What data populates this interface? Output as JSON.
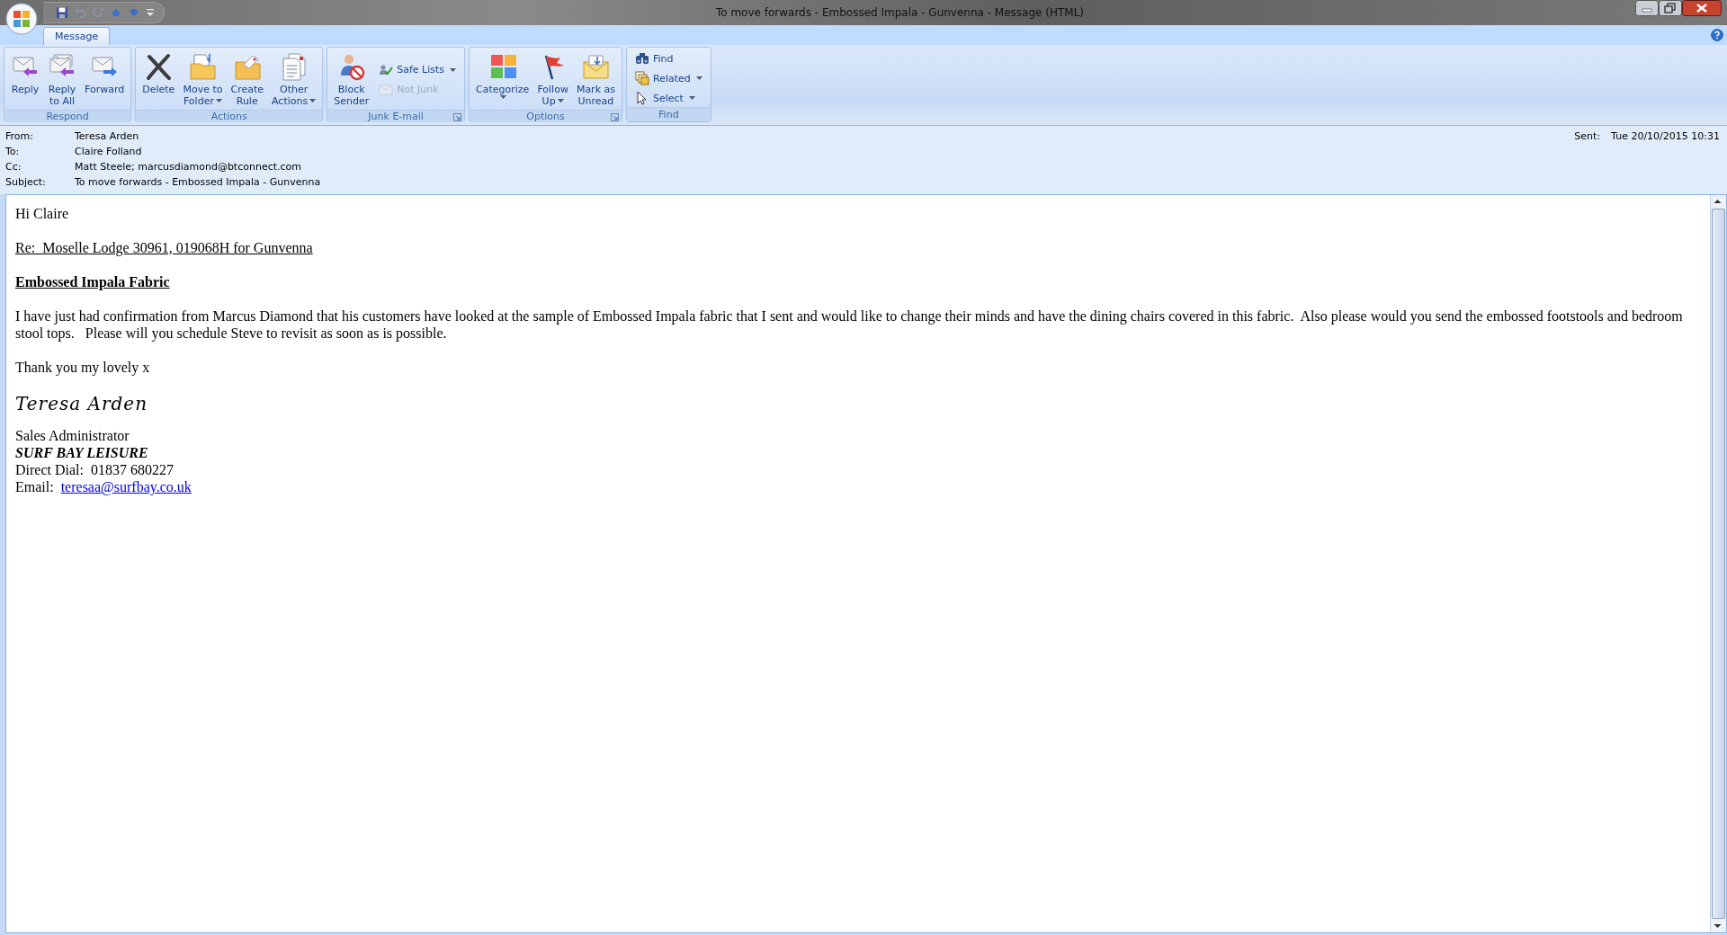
{
  "window": {
    "title": "To move forwards - Embossed Impala - Gunvenna  -  Message (HTML)"
  },
  "tabs": [
    {
      "label": "Message",
      "selected": true
    }
  ],
  "ribbon": {
    "groups": [
      {
        "label": "Respond",
        "launcher": false,
        "buttons": [
          {
            "kind": "large",
            "label": "Reply",
            "dropdown": false,
            "disabled": false
          },
          {
            "kind": "large",
            "label": "Reply\nto All",
            "dropdown": false,
            "disabled": false
          },
          {
            "kind": "large",
            "label": "Forward",
            "dropdown": false,
            "disabled": false
          }
        ]
      },
      {
        "label": "Actions",
        "launcher": false,
        "buttons": [
          {
            "kind": "large",
            "label": "Delete",
            "dropdown": false,
            "disabled": false
          },
          {
            "kind": "large",
            "label": "Move to\nFolder",
            "dropdown": true,
            "disabled": false
          },
          {
            "kind": "large",
            "label": "Create\nRule",
            "dropdown": false,
            "disabled": false
          },
          {
            "kind": "large",
            "label": "Other\nActions",
            "dropdown": true,
            "disabled": false
          }
        ]
      },
      {
        "label": "Junk E-mail",
        "launcher": true,
        "buttons": [
          {
            "kind": "large",
            "label": "Block\nSender",
            "dropdown": false,
            "disabled": false
          },
          {
            "kind": "small",
            "label": "Safe Lists",
            "dropdown": true,
            "disabled": false
          },
          {
            "kind": "small",
            "label": "Not Junk",
            "dropdown": false,
            "disabled": true
          }
        ]
      },
      {
        "label": "Options",
        "launcher": true,
        "buttons": [
          {
            "kind": "large",
            "label": "Categorize",
            "dropdown": true,
            "disabled": false
          },
          {
            "kind": "large",
            "label": "Follow\nUp",
            "dropdown": true,
            "disabled": false
          },
          {
            "kind": "large",
            "label": "Mark as\nUnread",
            "dropdown": false,
            "disabled": false
          }
        ]
      },
      {
        "label": "Find",
        "launcher": false,
        "buttons": [
          {
            "kind": "small",
            "label": "Find",
            "dropdown": false,
            "disabled": false
          },
          {
            "kind": "small",
            "label": "Related",
            "dropdown": true,
            "disabled": false
          },
          {
            "kind": "small",
            "label": "Select",
            "dropdown": true,
            "disabled": false
          }
        ]
      }
    ]
  },
  "header": {
    "fields": [
      {
        "label": "From:",
        "value": "Teresa Arden"
      },
      {
        "label": "To:",
        "value": "Claire Folland"
      },
      {
        "label": "Cc:",
        "value": "Matt Steele; marcusdiamond@btconnect.com"
      },
      {
        "label": "Subject:",
        "value": "To move forwards - Embossed Impala - Gunvenna"
      }
    ],
    "sent": {
      "label": "Sent:",
      "value": "Tue 20/10/2015 10:31"
    }
  },
  "body": {
    "blocks": [
      {
        "kind": "text",
        "text": "Hi Claire"
      },
      {
        "kind": "underlined",
        "text": "Re:  Moselle Lodge 30961, 019068H for Gunvenna"
      },
      {
        "kind": "heading",
        "text": "Embossed Impala Fabric"
      },
      {
        "kind": "text",
        "text": "I have just had confirmation from Marcus Diamond that his customers have looked at the sample of Embossed Impala fabric that I sent and would like to change their minds and have the dining chairs covered in this fabric.  Also please would you send the embossed footstools and bedroom stool tops.   Please will you schedule Steve to revisit as soon as is possible."
      },
      {
        "kind": "text",
        "text": "Thank you my lovely x"
      },
      {
        "kind": "script",
        "text": "Teresa Arden"
      }
    ],
    "signature": {
      "title": "Sales Administrator",
      "company": "SURF BAY LEISURE",
      "direct_dial": "Direct Dial:  01837 680227",
      "email_label": "Email:",
      "email": "teresaa@surfbay.co.uk"
    }
  }
}
